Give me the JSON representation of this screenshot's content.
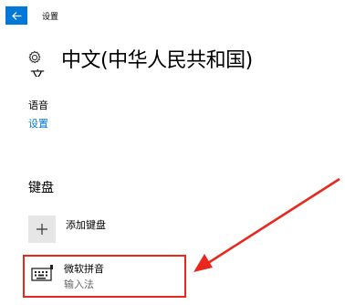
{
  "titlebar": {
    "title": "设置"
  },
  "page": {
    "title": "中文(中华人民共和国)",
    "clipped_text": "文"
  },
  "language": {
    "label": "语音",
    "settings_link": "设置"
  },
  "keyboard": {
    "header": "键盘",
    "add_label": "添加键盘",
    "items": [
      {
        "name": "微软拼音",
        "subtitle": "输入法"
      }
    ]
  },
  "icons": {
    "back": "back-arrow-icon",
    "gear": "gear-icon",
    "plus": "plus-icon",
    "keyboard": "keyboard-icon"
  },
  "colors": {
    "accent": "#0078d7",
    "highlight": "#e8271d"
  }
}
